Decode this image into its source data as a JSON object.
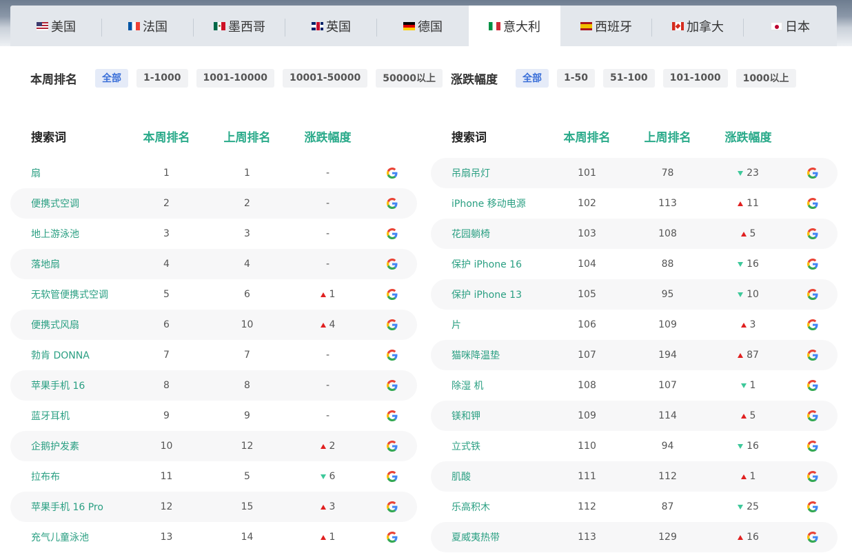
{
  "countries": [
    {
      "name": "美国",
      "flag": "flag-us",
      "active": false
    },
    {
      "name": "法国",
      "flag": "flag-fr",
      "active": false
    },
    {
      "name": "墨西哥",
      "flag": "flag-mx",
      "active": false
    },
    {
      "name": "英国",
      "flag": "flag-gb",
      "active": false
    },
    {
      "name": "德国",
      "flag": "flag-de",
      "active": false
    },
    {
      "name": "意大利",
      "flag": "flag-it",
      "active": true
    },
    {
      "name": "西班牙",
      "flag": "flag-es",
      "active": false
    },
    {
      "name": "加拿大",
      "flag": "flag-ca",
      "active": false
    },
    {
      "name": "日本",
      "flag": "flag-jp",
      "active": false
    }
  ],
  "filters": {
    "rank": {
      "label": "本周排名",
      "options": [
        {
          "label": "全部",
          "active": true
        },
        {
          "label": "1-1000",
          "active": false
        },
        {
          "label": "1001-10000",
          "active": false
        },
        {
          "label": "10001-50000",
          "active": false
        },
        {
          "label": "50000以上",
          "active": false
        }
      ]
    },
    "change": {
      "label": "涨跌幅度",
      "options": [
        {
          "label": "全部",
          "active": true
        },
        {
          "label": "1-50",
          "active": false
        },
        {
          "label": "51-100",
          "active": false
        },
        {
          "label": "101-1000",
          "active": false
        },
        {
          "label": "1000以上",
          "active": false
        }
      ]
    }
  },
  "table_headers": {
    "term": "搜索词",
    "this_week": "本周排名",
    "last_week": "上周排名",
    "change": "涨跌幅度"
  },
  "colors": {
    "accent_green": "#2aaa8a",
    "up_red": "#e02020",
    "down_green": "#3ec89a",
    "active_chip_blue": "#3a6fd8"
  },
  "left_table": [
    {
      "term": "扇",
      "this_week": "1",
      "last_week": "1",
      "dir": "none",
      "change": "-"
    },
    {
      "term": "便携式空调",
      "this_week": "2",
      "last_week": "2",
      "dir": "none",
      "change": "-"
    },
    {
      "term": "地上游泳池",
      "this_week": "3",
      "last_week": "3",
      "dir": "none",
      "change": "-"
    },
    {
      "term": "落地扇",
      "this_week": "4",
      "last_week": "4",
      "dir": "none",
      "change": "-"
    },
    {
      "term": "无软管便携式空调",
      "this_week": "5",
      "last_week": "6",
      "dir": "up",
      "change": "1"
    },
    {
      "term": "便携式风扇",
      "this_week": "6",
      "last_week": "10",
      "dir": "up",
      "change": "4"
    },
    {
      "term": "勃肯 DONNA",
      "this_week": "7",
      "last_week": "7",
      "dir": "none",
      "change": "-"
    },
    {
      "term": "苹果手机 16",
      "this_week": "8",
      "last_week": "8",
      "dir": "none",
      "change": "-"
    },
    {
      "term": "蓝牙耳机",
      "this_week": "9",
      "last_week": "9",
      "dir": "none",
      "change": "-"
    },
    {
      "term": "企鹅护发素",
      "this_week": "10",
      "last_week": "12",
      "dir": "up",
      "change": "2"
    },
    {
      "term": "拉布布",
      "this_week": "11",
      "last_week": "5",
      "dir": "down",
      "change": "6"
    },
    {
      "term": "苹果手机 16 Pro",
      "this_week": "12",
      "last_week": "15",
      "dir": "up",
      "change": "3"
    },
    {
      "term": "充气儿童泳池",
      "this_week": "13",
      "last_week": "14",
      "dir": "up",
      "change": "1"
    }
  ],
  "right_table": [
    {
      "term": "吊扇吊灯",
      "this_week": "101",
      "last_week": "78",
      "dir": "down",
      "change": "23"
    },
    {
      "term": "iPhone 移动电源",
      "this_week": "102",
      "last_week": "113",
      "dir": "up",
      "change": "11"
    },
    {
      "term": "花园躺椅",
      "this_week": "103",
      "last_week": "108",
      "dir": "up",
      "change": "5"
    },
    {
      "term": "保护 iPhone 16",
      "this_week": "104",
      "last_week": "88",
      "dir": "down",
      "change": "16"
    },
    {
      "term": "保护 iPhone 13",
      "this_week": "105",
      "last_week": "95",
      "dir": "down",
      "change": "10"
    },
    {
      "term": "片",
      "this_week": "106",
      "last_week": "109",
      "dir": "up",
      "change": "3"
    },
    {
      "term": "猫咪降温垫",
      "this_week": "107",
      "last_week": "194",
      "dir": "up",
      "change": "87"
    },
    {
      "term": "除湿 机",
      "this_week": "108",
      "last_week": "107",
      "dir": "down",
      "change": "1"
    },
    {
      "term": "镁和钾",
      "this_week": "109",
      "last_week": "114",
      "dir": "up",
      "change": "5"
    },
    {
      "term": "立式铁",
      "this_week": "110",
      "last_week": "94",
      "dir": "down",
      "change": "16"
    },
    {
      "term": "肌酸",
      "this_week": "111",
      "last_week": "112",
      "dir": "up",
      "change": "1"
    },
    {
      "term": "乐高积木",
      "this_week": "112",
      "last_week": "87",
      "dir": "down",
      "change": "25"
    },
    {
      "term": "夏威夷热带",
      "this_week": "113",
      "last_week": "129",
      "dir": "up",
      "change": "16"
    }
  ]
}
